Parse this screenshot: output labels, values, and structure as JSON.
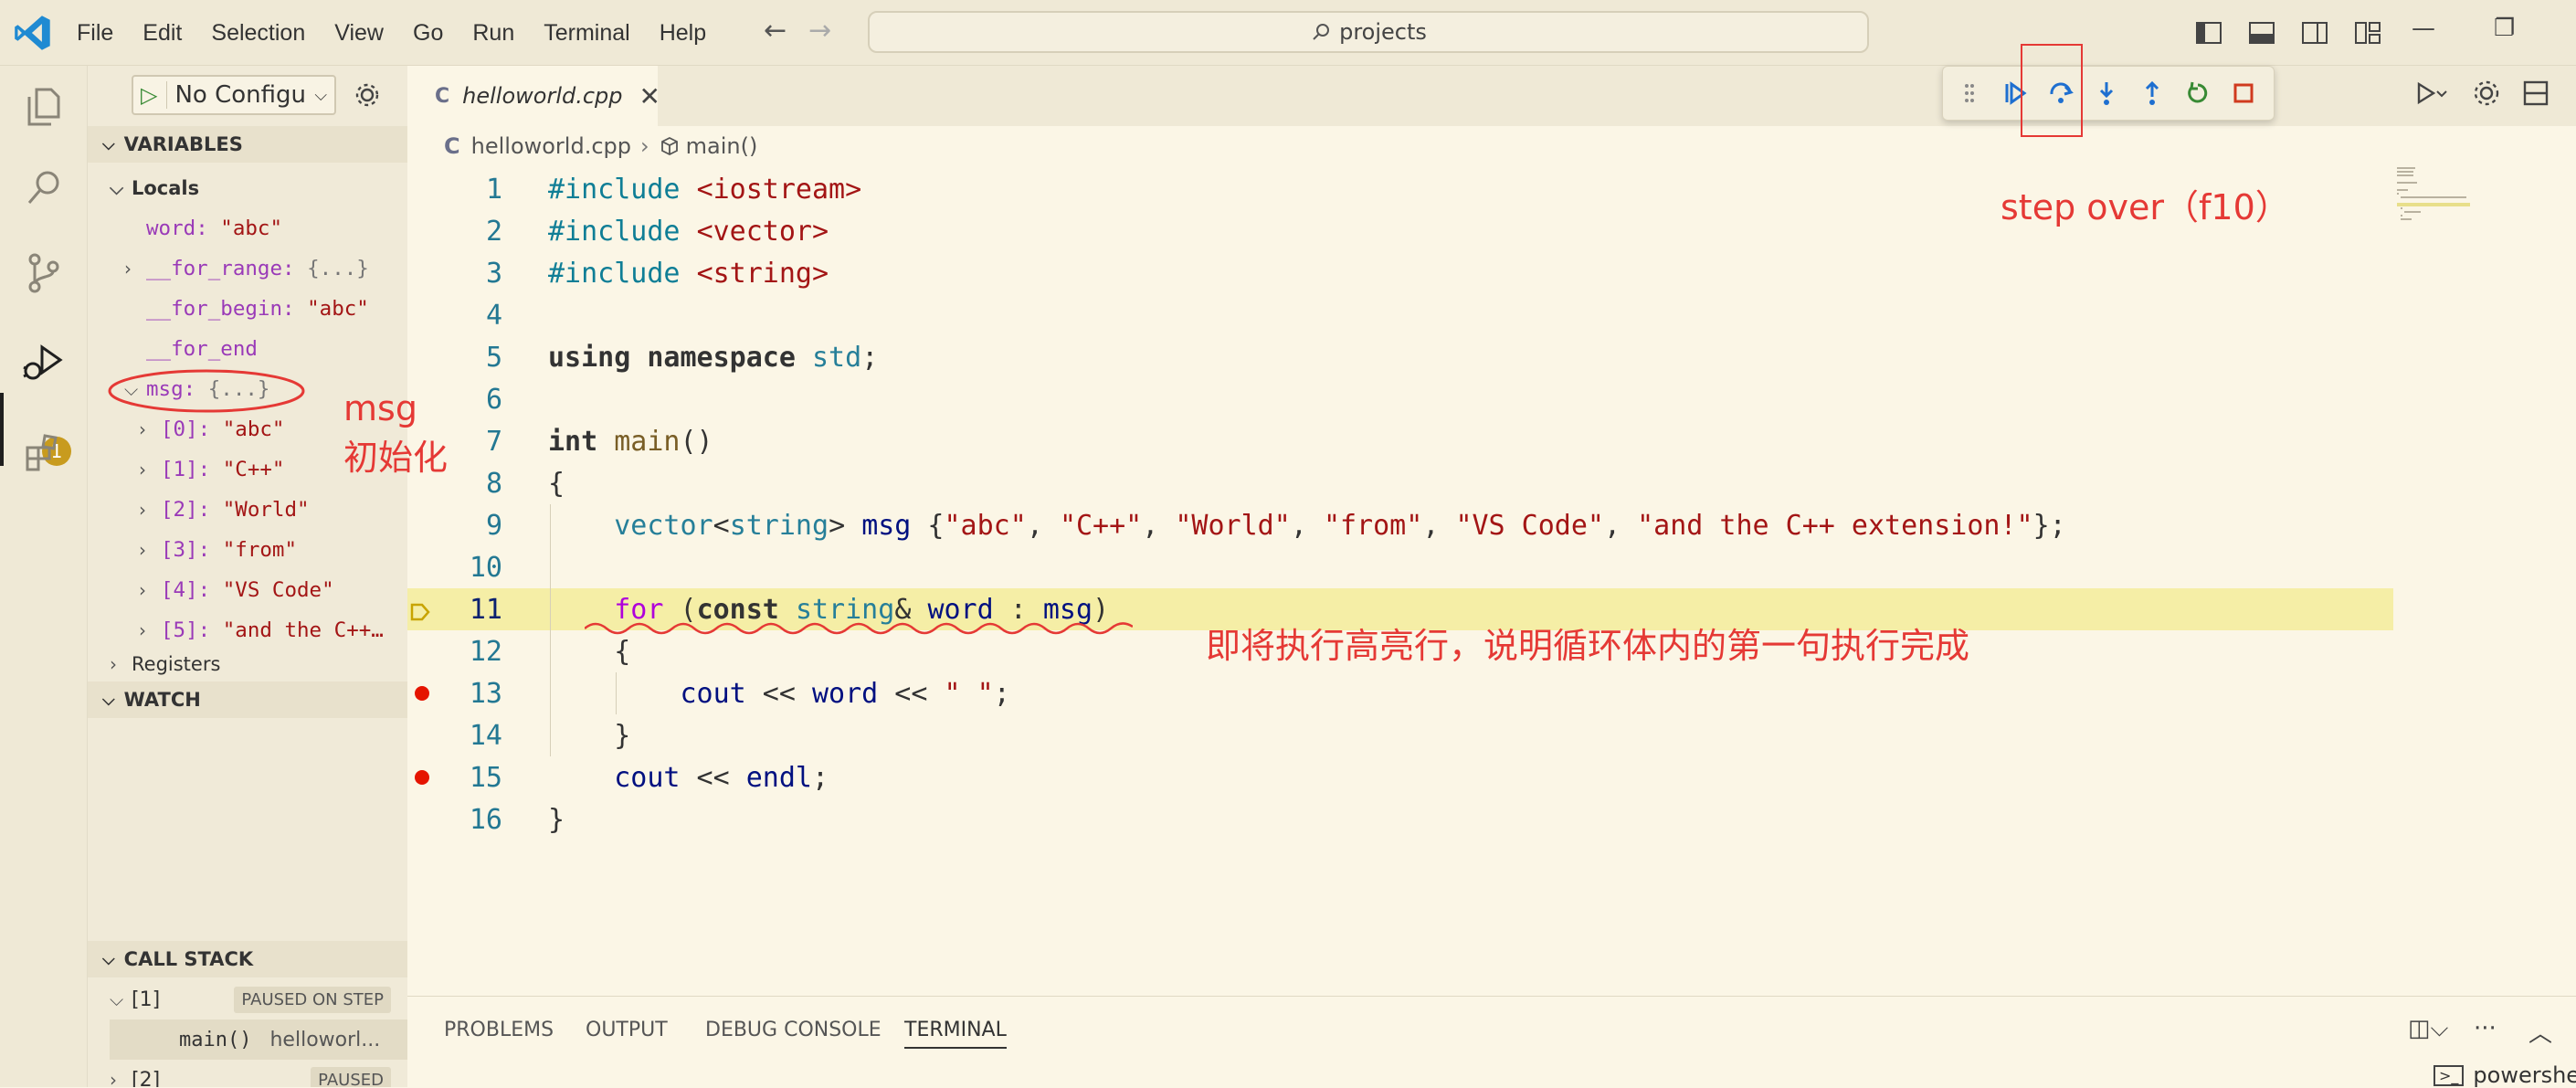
{
  "titlebar": {
    "menu": [
      "File",
      "Edit",
      "Selection",
      "View",
      "Go",
      "Run",
      "Terminal",
      "Help"
    ],
    "search": "projects"
  },
  "sidebar": {
    "run_config": "No Configu",
    "variables_title": "VARIABLES",
    "locals_label": "Locals",
    "locals": [
      {
        "key": "word",
        "sep": ": ",
        "val": "\"abc\"",
        "expand": false,
        "indent": 1
      },
      {
        "key": "__for_range",
        "sep": ": ",
        "val": "{...}",
        "expand": "closed",
        "indent": 1,
        "obj": true
      },
      {
        "key": "__for_begin",
        "sep": ": ",
        "val": "\"abc\"",
        "expand": false,
        "indent": 1
      },
      {
        "key": "__for_end",
        "sep": "",
        "val": "",
        "expand": false,
        "indent": 1
      },
      {
        "key": "msg",
        "sep": ": ",
        "val": "{...}",
        "expand": "open",
        "indent": 1,
        "obj": true
      },
      {
        "key": "[0]",
        "sep": ": ",
        "val": "\"abc\"",
        "expand": "closed",
        "indent": 2
      },
      {
        "key": "[1]",
        "sep": ": ",
        "val": "\"C++\"",
        "expand": "closed",
        "indent": 2
      },
      {
        "key": "[2]",
        "sep": ": ",
        "val": "\"World\"",
        "expand": "closed",
        "indent": 2
      },
      {
        "key": "[3]",
        "sep": ": ",
        "val": "\"from\"",
        "expand": "closed",
        "indent": 2
      },
      {
        "key": "[4]",
        "sep": ": ",
        "val": "\"VS Code\"",
        "expand": "closed",
        "indent": 2
      },
      {
        "key": "[5]",
        "sep": ": ",
        "val": "\"and the C++…",
        "expand": "closed",
        "indent": 2
      }
    ],
    "registers_label": "Registers",
    "watch_title": "WATCH",
    "callstack_title": "CALL STACK",
    "callstack": [
      {
        "label": "[1]",
        "badge": "PAUSED ON STEP"
      },
      {
        "frame": "main()",
        "file": "helloworl..."
      },
      {
        "label": "[2]",
        "badge": "PAUSED"
      }
    ]
  },
  "editor": {
    "tab": "helloworld.cpp",
    "breadcrumb": {
      "file": "helloworld.cpp",
      "symbol": "main()"
    },
    "current_line": 11,
    "breakpoints": [
      13,
      15
    ],
    "lines": [
      {
        "n": "1",
        "t": "#include <iostream>"
      },
      {
        "n": "2",
        "t": "#include <vector>"
      },
      {
        "n": "3",
        "t": "#include <string>"
      },
      {
        "n": "4",
        "t": ""
      },
      {
        "n": "5",
        "t": "using namespace std;"
      },
      {
        "n": "6",
        "t": ""
      },
      {
        "n": "7",
        "t": "int main()"
      },
      {
        "n": "8",
        "t": "{"
      },
      {
        "n": "9",
        "t": "    vector<string> msg {\"abc\", \"C++\", \"World\", \"from\", \"VS Code\", \"and the C++ extension!\"};"
      },
      {
        "n": "10",
        "t": ""
      },
      {
        "n": "11",
        "t": "    for (const string& word : msg)"
      },
      {
        "n": "12",
        "t": "    {"
      },
      {
        "n": "13",
        "t": "        cout << word << \" \";"
      },
      {
        "n": "14",
        "t": "    }"
      },
      {
        "n": "15",
        "t": "    cout << endl;"
      },
      {
        "n": "16",
        "t": "}"
      }
    ]
  },
  "annotations": {
    "step_over": "step over（f10）",
    "msg_line1": "msg",
    "msg_line2": "初始化",
    "highlight_note": "即将执行高亮行，说明循环体内的第一句执行完成"
  },
  "panel": {
    "tabs": [
      "PROBLEMS",
      "OUTPUT",
      "DEBUG CONSOLE",
      "TERMINAL"
    ],
    "active": "TERMINAL",
    "terminal_name": "powershe"
  },
  "colors": {
    "accent_red": "#e53935",
    "debug_blue": "#1e6fd0",
    "highlight": "#f5eea6",
    "breakpoint": "#e51400"
  }
}
